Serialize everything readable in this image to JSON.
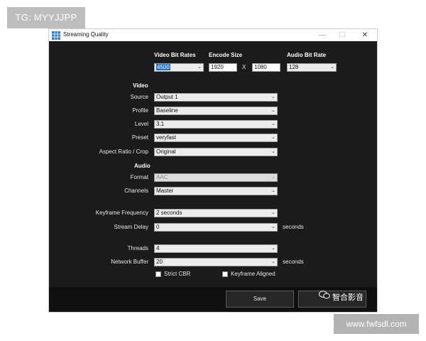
{
  "watermarks": {
    "top_left": "TG: MYYJJPP",
    "bottom_right": "www.fwfsdl.com",
    "wechat": "智合影音"
  },
  "window": {
    "title": "Streaming Quality",
    "minimize_glyph": "—",
    "maximize_glyph": "☐",
    "close_glyph": "✕"
  },
  "top": {
    "video_bit_rates_label": "Video Bit Rates",
    "video_bit_rate": "4500",
    "encode_size_label": "Encode Size",
    "encode_width": "1920",
    "encode_x": "X",
    "encode_height": "1080",
    "audio_bit_rate_label": "Audio Bit Rate",
    "audio_bit_rate": "128"
  },
  "video": {
    "header": "Video",
    "source_label": "Source",
    "source": "Output 1",
    "profile_label": "Profile",
    "profile": "Baseline",
    "level_label": "Level",
    "level": "3.1",
    "preset_label": "Preset",
    "preset": "veryfast",
    "aspect_label": "Aspect Ratio / Crop",
    "aspect": "Original"
  },
  "audio": {
    "header": "Audio",
    "format_label": "Format",
    "format": "AAC",
    "channels_label": "Channels",
    "channels": "Master"
  },
  "advanced": {
    "keyframe_label": "Keyframe Frequency",
    "keyframe": "2 seconds",
    "stream_delay_label": "Stream Delay",
    "stream_delay": "0",
    "stream_delay_unit": "seconds",
    "threads_label": "Threads",
    "threads": "4",
    "network_buffer_label": "Network Buffer",
    "network_buffer": "20",
    "network_buffer_unit": "seconds",
    "strict_cbr_label": "Strict CBR",
    "keyframe_aligned_label": "Keyframe Aligned"
  },
  "footer": {
    "save_label": "Save",
    "cancel_label": ""
  },
  "icons": {
    "app": "grid-icon",
    "dropdown": "chevron-down-icon",
    "wechat": "wechat-icon"
  },
  "colors": {
    "window_bg": "#1b1b1b",
    "highlight": "#1e6fd4"
  }
}
